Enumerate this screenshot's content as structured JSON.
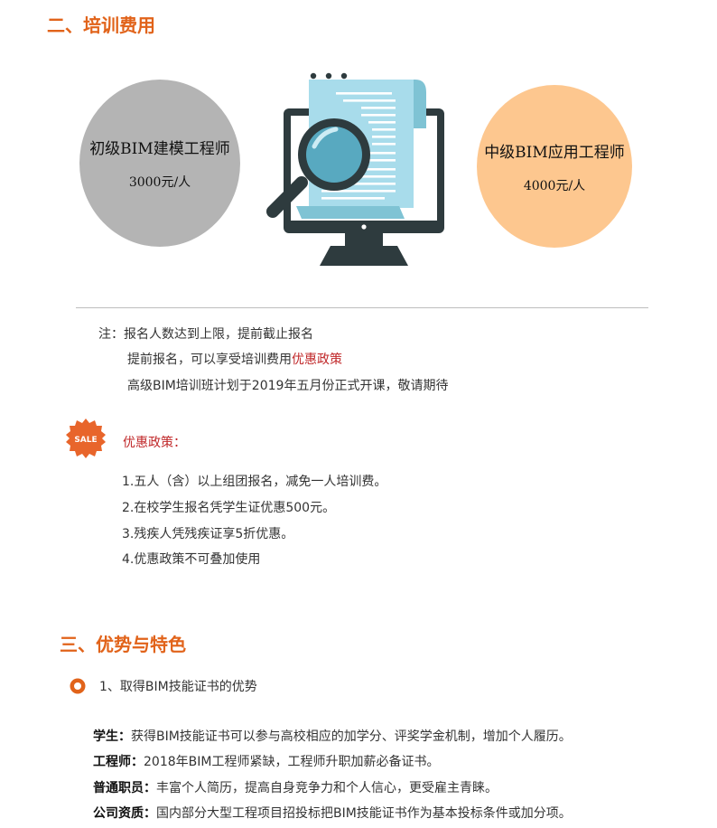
{
  "section2": {
    "title": "二、培训费用",
    "junior": {
      "name": "初级BIM建模工程师",
      "price": "3000元/人"
    },
    "middle": {
      "name": "中级BIM应用工程师",
      "price": "4000元/人"
    }
  },
  "notes": {
    "line1": "注：报名人数达到上限，提前截止报名",
    "line2_prefix": "提前报名，可以享受培训费用",
    "line2_link": "优惠政策",
    "line3": "高级BIM培训班计划于2019年五月份正式开课，敬请期待"
  },
  "policy": {
    "badge": "SALE",
    "title": "优惠政策：",
    "items": [
      "1.五人（含）以上组团报名，减免一人培训费。",
      "2.在校学生报名凭学生证优惠500元。",
      "3.残疾人凭残疾证享5折优惠。",
      "4.优惠政策不可叠加使用"
    ]
  },
  "section3": {
    "title": "三、优势与特色",
    "subtitle": "1、取得BIM技能证书的优势",
    "rows": [
      {
        "label": "学生：",
        "text": "获得BIM技能证书可以参与高校相应的加学分、评奖学金机制，增加个人履历。"
      },
      {
        "label": "工程师：",
        "text": "2018年BIM工程师紧缺，工程师升职加薪必备证书。"
      },
      {
        "label": "普通职员：",
        "text": "丰富个人简历，提高自身竞争力和个人信心，更受雇主青睐。"
      },
      {
        "label": "公司资质：",
        "text": "国内部分大型工程项目招投标把BIM技能证书作为基本投标条件或加分项。"
      }
    ]
  },
  "colors": {
    "accent": "#e1631a",
    "highlight": "#c0282a",
    "gray_circle": "#b4b4b4",
    "orange_circle": "#fdc78f"
  }
}
